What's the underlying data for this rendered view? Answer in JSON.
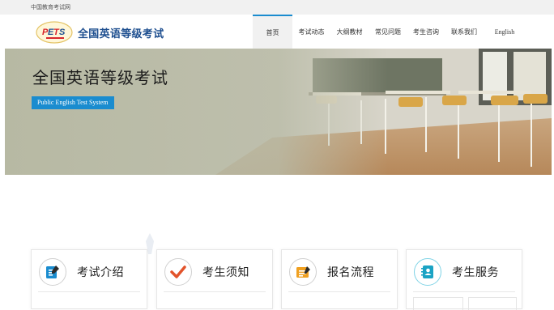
{
  "topbar": {
    "site_name": "中国教育考试网"
  },
  "header": {
    "logo_text": "全国英语等级考试",
    "nav": [
      {
        "label": "首页",
        "active": true
      },
      {
        "label": "考试动态"
      },
      {
        "label": "大纲教材"
      },
      {
        "label": "常见问题"
      },
      {
        "label": "考生咨询"
      },
      {
        "label": "联系我们"
      },
      {
        "label": "English"
      }
    ]
  },
  "hero": {
    "title": "全国英语等级考试",
    "badge": "Public English Test System"
  },
  "cards": [
    {
      "label": "考试介绍",
      "icon": "document-icon",
      "color": "#1a8ccf"
    },
    {
      "label": "考生须知",
      "icon": "checkmark-icon",
      "color": "#e2532b"
    },
    {
      "label": "报名流程",
      "icon": "form-icon",
      "color": "#f0a020"
    },
    {
      "label": "考生服务",
      "icon": "contact-book-icon",
      "color": "#1aa3c4"
    }
  ],
  "colors": {
    "accent": "#1a8ccf",
    "brand": "#1d4e8f"
  }
}
